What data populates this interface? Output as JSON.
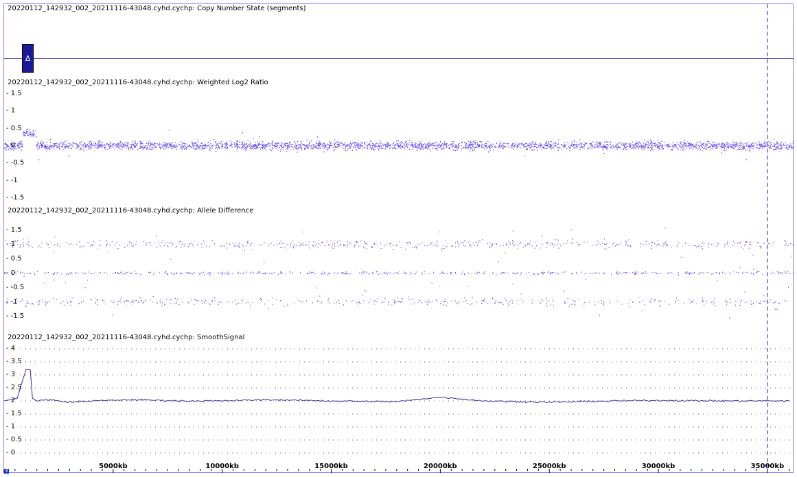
{
  "tracks": {
    "copy_number": {
      "title": "20220112_142932_002_20211116-43048.cyhd.cychp: Copy Number State (segments)",
      "marker_glyph": "Δ"
    },
    "log2": {
      "title": "20220112_142932_002_20211116-43048.cyhd.cychp: Weighted Log2 Ratio",
      "y_ticks": [
        "1.5",
        "1",
        "0.5",
        "0",
        "-0.5",
        "-1",
        "-1.5"
      ]
    },
    "allele": {
      "title": "20220112_142932_002_20211116-43048.cyhd.cychp: Allele Difference",
      "y_ticks": [
        "1.5",
        "1",
        "0.5",
        "0",
        "-0.5",
        "-1",
        "-1.5"
      ]
    },
    "smooth": {
      "title": "20220112_142932_002_20211116-43048.cyhd.cychp: SmoothSignal",
      "y_ticks": [
        "4",
        "3.5",
        "3",
        "2.5",
        "2",
        "1.5",
        "1",
        "0.5",
        "0"
      ]
    }
  },
  "x_axis": {
    "labels": [
      "5000kb",
      "10000kb",
      "15000kb",
      "20000kb",
      "25000kb",
      "30000kb",
      "35000kb"
    ]
  },
  "corner_label": "3",
  "colors": {
    "points": "#6a4cf0",
    "line": "#3b2a9e",
    "frame": "#8a8aff"
  },
  "chart_data": {
    "type": "scatter",
    "x_unit": "kb",
    "xlim": [
      0,
      36200
    ],
    "smooth_signal": {
      "x": [
        0,
        600,
        1000,
        1200,
        1300,
        1400,
        1500,
        2000,
        3000,
        4000,
        6000,
        8000,
        10000,
        12000,
        15000,
        18000,
        20000,
        22000,
        25000,
        28000,
        30000,
        33000,
        36000
      ],
      "y": [
        2.0,
        2.1,
        3.2,
        3.2,
        2.1,
        2.05,
        2.0,
        2.05,
        1.95,
        2.0,
        2.05,
        2.0,
        2.0,
        2.05,
        2.0,
        1.97,
        2.15,
        2.0,
        1.95,
        2.0,
        2.02,
        2.0,
        2.0
      ]
    },
    "log2_ratio_baseline": 0.0,
    "allele_difference_bands": [
      1.0,
      0.0,
      -1.0
    ]
  }
}
